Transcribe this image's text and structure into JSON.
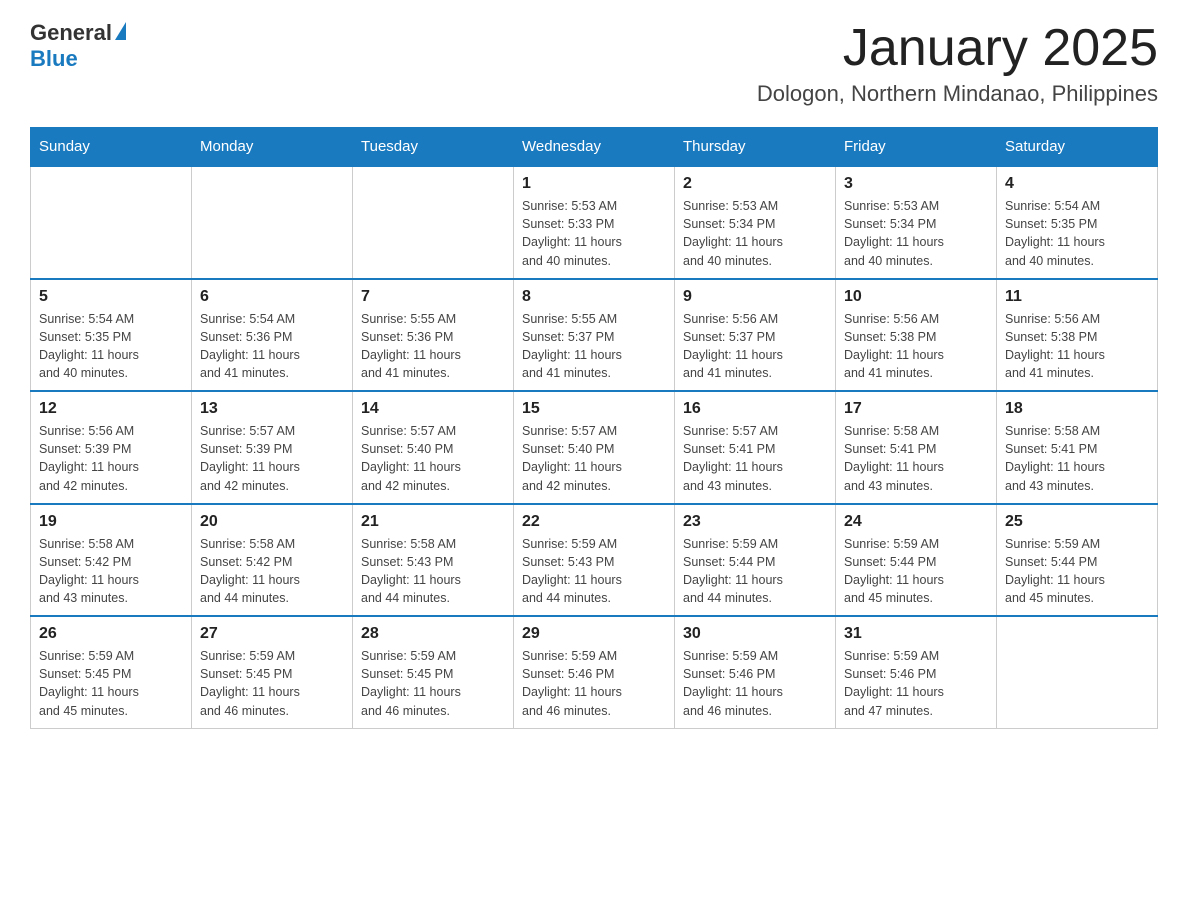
{
  "logo": {
    "general": "General",
    "blue": "Blue"
  },
  "title": "January 2025",
  "location": "Dologon, Northern Mindanao, Philippines",
  "days_of_week": [
    "Sunday",
    "Monday",
    "Tuesday",
    "Wednesday",
    "Thursday",
    "Friday",
    "Saturday"
  ],
  "weeks": [
    [
      {
        "day": "",
        "info": ""
      },
      {
        "day": "",
        "info": ""
      },
      {
        "day": "",
        "info": ""
      },
      {
        "day": "1",
        "info": "Sunrise: 5:53 AM\nSunset: 5:33 PM\nDaylight: 11 hours\nand 40 minutes."
      },
      {
        "day": "2",
        "info": "Sunrise: 5:53 AM\nSunset: 5:34 PM\nDaylight: 11 hours\nand 40 minutes."
      },
      {
        "day": "3",
        "info": "Sunrise: 5:53 AM\nSunset: 5:34 PM\nDaylight: 11 hours\nand 40 minutes."
      },
      {
        "day": "4",
        "info": "Sunrise: 5:54 AM\nSunset: 5:35 PM\nDaylight: 11 hours\nand 40 minutes."
      }
    ],
    [
      {
        "day": "5",
        "info": "Sunrise: 5:54 AM\nSunset: 5:35 PM\nDaylight: 11 hours\nand 40 minutes."
      },
      {
        "day": "6",
        "info": "Sunrise: 5:54 AM\nSunset: 5:36 PM\nDaylight: 11 hours\nand 41 minutes."
      },
      {
        "day": "7",
        "info": "Sunrise: 5:55 AM\nSunset: 5:36 PM\nDaylight: 11 hours\nand 41 minutes."
      },
      {
        "day": "8",
        "info": "Sunrise: 5:55 AM\nSunset: 5:37 PM\nDaylight: 11 hours\nand 41 minutes."
      },
      {
        "day": "9",
        "info": "Sunrise: 5:56 AM\nSunset: 5:37 PM\nDaylight: 11 hours\nand 41 minutes."
      },
      {
        "day": "10",
        "info": "Sunrise: 5:56 AM\nSunset: 5:38 PM\nDaylight: 11 hours\nand 41 minutes."
      },
      {
        "day": "11",
        "info": "Sunrise: 5:56 AM\nSunset: 5:38 PM\nDaylight: 11 hours\nand 41 minutes."
      }
    ],
    [
      {
        "day": "12",
        "info": "Sunrise: 5:56 AM\nSunset: 5:39 PM\nDaylight: 11 hours\nand 42 minutes."
      },
      {
        "day": "13",
        "info": "Sunrise: 5:57 AM\nSunset: 5:39 PM\nDaylight: 11 hours\nand 42 minutes."
      },
      {
        "day": "14",
        "info": "Sunrise: 5:57 AM\nSunset: 5:40 PM\nDaylight: 11 hours\nand 42 minutes."
      },
      {
        "day": "15",
        "info": "Sunrise: 5:57 AM\nSunset: 5:40 PM\nDaylight: 11 hours\nand 42 minutes."
      },
      {
        "day": "16",
        "info": "Sunrise: 5:57 AM\nSunset: 5:41 PM\nDaylight: 11 hours\nand 43 minutes."
      },
      {
        "day": "17",
        "info": "Sunrise: 5:58 AM\nSunset: 5:41 PM\nDaylight: 11 hours\nand 43 minutes."
      },
      {
        "day": "18",
        "info": "Sunrise: 5:58 AM\nSunset: 5:41 PM\nDaylight: 11 hours\nand 43 minutes."
      }
    ],
    [
      {
        "day": "19",
        "info": "Sunrise: 5:58 AM\nSunset: 5:42 PM\nDaylight: 11 hours\nand 43 minutes."
      },
      {
        "day": "20",
        "info": "Sunrise: 5:58 AM\nSunset: 5:42 PM\nDaylight: 11 hours\nand 44 minutes."
      },
      {
        "day": "21",
        "info": "Sunrise: 5:58 AM\nSunset: 5:43 PM\nDaylight: 11 hours\nand 44 minutes."
      },
      {
        "day": "22",
        "info": "Sunrise: 5:59 AM\nSunset: 5:43 PM\nDaylight: 11 hours\nand 44 minutes."
      },
      {
        "day": "23",
        "info": "Sunrise: 5:59 AM\nSunset: 5:44 PM\nDaylight: 11 hours\nand 44 minutes."
      },
      {
        "day": "24",
        "info": "Sunrise: 5:59 AM\nSunset: 5:44 PM\nDaylight: 11 hours\nand 45 minutes."
      },
      {
        "day": "25",
        "info": "Sunrise: 5:59 AM\nSunset: 5:44 PM\nDaylight: 11 hours\nand 45 minutes."
      }
    ],
    [
      {
        "day": "26",
        "info": "Sunrise: 5:59 AM\nSunset: 5:45 PM\nDaylight: 11 hours\nand 45 minutes."
      },
      {
        "day": "27",
        "info": "Sunrise: 5:59 AM\nSunset: 5:45 PM\nDaylight: 11 hours\nand 46 minutes."
      },
      {
        "day": "28",
        "info": "Sunrise: 5:59 AM\nSunset: 5:45 PM\nDaylight: 11 hours\nand 46 minutes."
      },
      {
        "day": "29",
        "info": "Sunrise: 5:59 AM\nSunset: 5:46 PM\nDaylight: 11 hours\nand 46 minutes."
      },
      {
        "day": "30",
        "info": "Sunrise: 5:59 AM\nSunset: 5:46 PM\nDaylight: 11 hours\nand 46 minutes."
      },
      {
        "day": "31",
        "info": "Sunrise: 5:59 AM\nSunset: 5:46 PM\nDaylight: 11 hours\nand 47 minutes."
      },
      {
        "day": "",
        "info": ""
      }
    ]
  ]
}
